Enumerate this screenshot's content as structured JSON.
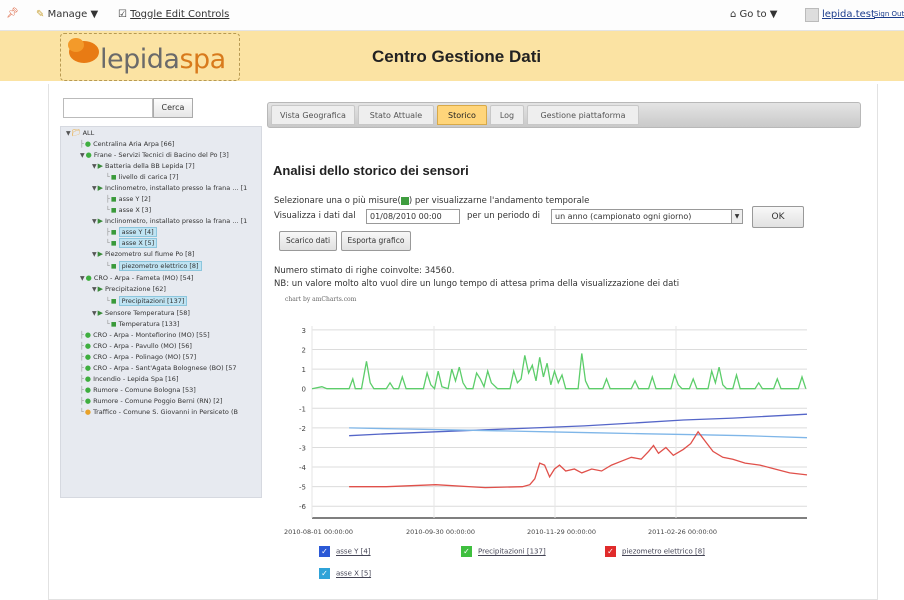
{
  "topbar": {
    "manage": "Manage ▼",
    "toggle": "Toggle Edit Controls",
    "goto": "Go to ▼",
    "user": "lepida.test",
    "signout": "Sign Out"
  },
  "header": {
    "logo_main": "lepida",
    "logo_spa": "spa",
    "title": "Centro Gestione Dati"
  },
  "search": {
    "placeholder": "",
    "button": "Cerca"
  },
  "tree": {
    "nodes": [
      {
        "label": "ALL"
      },
      {
        "label": "Centralina Aria Arpa [66]"
      },
      {
        "label": "Frane - Servizi Tecnici di Bacino del Po [3]"
      },
      {
        "label": "Batteria della BB Lepida [7]"
      },
      {
        "label": "livello di carica [7]"
      },
      {
        "label": "Inclinometro, installato presso la frana ... [1"
      },
      {
        "label": "asse Y [2]"
      },
      {
        "label": "asse X [3]"
      },
      {
        "label": "Inclinometro, installato presso la frana ... [1"
      },
      {
        "label": "asse Y [4]"
      },
      {
        "label": "asse X [5]"
      },
      {
        "label": "Piezometro sul fiume Po [8]"
      },
      {
        "label": "piezometro elettrico [8]"
      },
      {
        "label": "CRO - Arpa - Fameta (MO) [54]"
      },
      {
        "label": "Precipitazione [62]"
      },
      {
        "label": "Precipitazioni [137]"
      },
      {
        "label": "Sensore Temperatura [58]"
      },
      {
        "label": "Temperatura [133]"
      },
      {
        "label": "CRO - Arpa - Montefiorino (MO) [55]"
      },
      {
        "label": "CRO - Arpa - Pavullo (MO) [56]"
      },
      {
        "label": "CRO - Arpa - Polinago (MO) [57]"
      },
      {
        "label": "CRO - Arpa - Sant'Agata Bolognese (BO) [57"
      },
      {
        "label": "Incendio - Lepida Spa [16]"
      },
      {
        "label": "Rumore - Comune Bologna [53]"
      },
      {
        "label": "Rumore - Comune Poggio Berni (RN) [2]"
      },
      {
        "label": "Traffico - Comune S. Giovanni in Persiceto (B"
      }
    ]
  },
  "tabs": [
    {
      "label": "Vista Geografica"
    },
    {
      "label": "Stato Attuale"
    },
    {
      "label": "Storico"
    },
    {
      "label": "Log"
    },
    {
      "label": "Gestione piattaforma"
    }
  ],
  "main": {
    "heading": "Analisi dello storico dei sensori",
    "instr_before": "Selezionare una o più misure(",
    "instr_after": ") per visualizzarne l'andamento temporale",
    "show_data_from": "Visualizza i dati dal",
    "date_value": "01/08/2010 00:00",
    "period_label": "per un periodo di",
    "period_value": "un anno (campionato ogni giorno)",
    "ok": "OK",
    "download": "Scarico dati",
    "export": "Esporta grafico",
    "rows_estimate": "Numero stimato di righe coinvolte: 34560.",
    "note": "NB: un valore molto alto vuol dire un lungo tempo di attesa prima della visualizzazione dei dati",
    "credit": "chart by amCharts.com"
  },
  "colors": {
    "green": "#5ccd6a",
    "dark_blue": "#5566c8",
    "light_blue": "#7fb6e8",
    "red": "#e0504a",
    "banner": "#fbe3a3",
    "active_tab": "#ffd57a"
  },
  "chart_data": {
    "type": "line",
    "yticks": [
      "3",
      "2",
      "1",
      "0",
      "-1",
      "-2",
      "-3",
      "-4",
      "-5",
      "-6"
    ],
    "xticks": [
      "2010-08-01 00:00:00",
      "2010-09-30 00:00:00",
      "2010-11-29 00:00:00",
      "2011-02-26 00:00:00"
    ],
    "ylim": [
      -6.6,
      3.2
    ],
    "x_days_range": [
      0,
      400
    ],
    "grid": true,
    "series": [
      {
        "name": "asse Y [4]",
        "color": "#5566c8",
        "points": [
          [
            30,
            -2.4
          ],
          [
            60,
            -2.3
          ],
          [
            100,
            -2.2
          ],
          [
            140,
            -2.1
          ],
          [
            180,
            -2.0
          ],
          [
            220,
            -1.9
          ],
          [
            260,
            -1.75
          ],
          [
            300,
            -1.6
          ],
          [
            340,
            -1.5
          ],
          [
            400,
            -1.3
          ]
        ]
      },
      {
        "name": "Precipitazioni [137]",
        "color": "#5ccd6a",
        "points": [
          [
            0,
            0
          ],
          [
            8,
            0.1
          ],
          [
            12,
            0
          ],
          [
            30,
            0
          ],
          [
            33,
            0.5
          ],
          [
            35,
            0
          ],
          [
            40,
            0
          ],
          [
            44,
            1.4
          ],
          [
            47,
            0.3
          ],
          [
            50,
            0
          ],
          [
            60,
            0
          ],
          [
            63,
            0.3
          ],
          [
            66,
            0
          ],
          [
            70,
            0
          ],
          [
            73,
            0.6
          ],
          [
            76,
            0
          ],
          [
            90,
            0
          ],
          [
            93,
            0.8
          ],
          [
            96,
            0.2
          ],
          [
            99,
            0
          ],
          [
            102,
            0.9
          ],
          [
            105,
            0.1
          ],
          [
            110,
            0
          ],
          [
            113,
            1.0
          ],
          [
            116,
            0.4
          ],
          [
            119,
            1.1
          ],
          [
            122,
            0.3
          ],
          [
            125,
            0
          ],
          [
            130,
            0
          ],
          [
            133,
            0.8
          ],
          [
            136,
            0.5
          ],
          [
            139,
            0.1
          ],
          [
            142,
            0.9
          ],
          [
            145,
            0.3
          ],
          [
            150,
            0
          ],
          [
            160,
            0
          ],
          [
            163,
            0.9
          ],
          [
            166,
            0.3
          ],
          [
            169,
            0.5
          ],
          [
            172,
            1.7
          ],
          [
            175,
            0.8
          ],
          [
            178,
            1.2
          ],
          [
            181,
            0.4
          ],
          [
            184,
            1.6
          ],
          [
            187,
            0.6
          ],
          [
            190,
            1.3
          ],
          [
            193,
            0.2
          ],
          [
            196,
            0.9
          ],
          [
            199,
            0.3
          ],
          [
            202,
            0.7
          ],
          [
            205,
            0
          ],
          [
            215,
            0
          ],
          [
            218,
            1.8
          ],
          [
            221,
            0.4
          ],
          [
            224,
            0
          ],
          [
            235,
            0
          ],
          [
            238,
            0.5
          ],
          [
            241,
            0
          ],
          [
            258,
            0
          ],
          [
            261,
            0.4
          ],
          [
            264,
            0
          ],
          [
            272,
            0
          ],
          [
            275,
            0.6
          ],
          [
            278,
            0
          ],
          [
            290,
            0
          ],
          [
            293,
            0.7
          ],
          [
            296,
            0.2
          ],
          [
            299,
            0
          ],
          [
            305,
            0
          ],
          [
            308,
            0.5
          ],
          [
            311,
            0
          ],
          [
            320,
            0
          ],
          [
            323,
            0.9
          ],
          [
            326,
            0.3
          ],
          [
            329,
            1.1
          ],
          [
            332,
            0.2
          ],
          [
            335,
            0
          ],
          [
            340,
            0
          ],
          [
            343,
            0.7
          ],
          [
            346,
            0
          ],
          [
            358,
            0
          ],
          [
            361,
            0.3
          ],
          [
            364,
            0
          ],
          [
            373,
            0
          ],
          [
            376,
            0.5
          ],
          [
            379,
            0
          ],
          [
            393,
            0
          ],
          [
            396,
            0.6
          ],
          [
            399,
            0
          ]
        ]
      },
      {
        "name": "asse X [5]",
        "color": "#7fb6e8",
        "points": [
          [
            30,
            -2.0
          ],
          [
            70,
            -2.05
          ],
          [
            110,
            -2.1
          ],
          [
            150,
            -2.15
          ],
          [
            190,
            -2.2
          ],
          [
            230,
            -2.25
          ],
          [
            270,
            -2.3
          ],
          [
            310,
            -2.35
          ],
          [
            350,
            -2.4
          ],
          [
            400,
            -2.5
          ]
        ]
      },
      {
        "name": "piezometro elettrico [8]",
        "color": "#e0504a",
        "points": [
          [
            30,
            -5.0
          ],
          [
            60,
            -5.0
          ],
          [
            100,
            -4.9
          ],
          [
            140,
            -5.05
          ],
          [
            170,
            -5.0
          ],
          [
            176,
            -4.9
          ],
          [
            180,
            -4.6
          ],
          [
            184,
            -3.8
          ],
          [
            188,
            -3.9
          ],
          [
            192,
            -4.5
          ],
          [
            196,
            -4.1
          ],
          [
            200,
            -3.9
          ],
          [
            205,
            -4.2
          ],
          [
            212,
            -4.1
          ],
          [
            218,
            -4.3
          ],
          [
            226,
            -4.1
          ],
          [
            234,
            -4.2
          ],
          [
            242,
            -3.9
          ],
          [
            250,
            -3.7
          ],
          [
            258,
            -3.5
          ],
          [
            266,
            -3.6
          ],
          [
            272,
            -3.2
          ],
          [
            276,
            -2.9
          ],
          [
            280,
            -3.3
          ],
          [
            286,
            -3.0
          ],
          [
            292,
            -3.4
          ],
          [
            300,
            -3.1
          ],
          [
            306,
            -2.8
          ],
          [
            312,
            -2.2
          ],
          [
            318,
            -2.7
          ],
          [
            324,
            -3.2
          ],
          [
            332,
            -3.5
          ],
          [
            340,
            -3.6
          ],
          [
            350,
            -3.8
          ],
          [
            362,
            -3.9
          ],
          [
            374,
            -4.1
          ],
          [
            386,
            -4.3
          ],
          [
            400,
            -4.4
          ]
        ]
      }
    ],
    "legend_position": "bottom"
  },
  "legend": [
    {
      "label": "asse Y [4]",
      "color": "#2b59d6"
    },
    {
      "label": "Precipitazioni [137]",
      "color": "#3fbf3f"
    },
    {
      "label": "piezometro elettrico [8]",
      "color": "#e02b2b"
    },
    {
      "label": "asse X [5]",
      "color": "#2fa3d8"
    }
  ]
}
